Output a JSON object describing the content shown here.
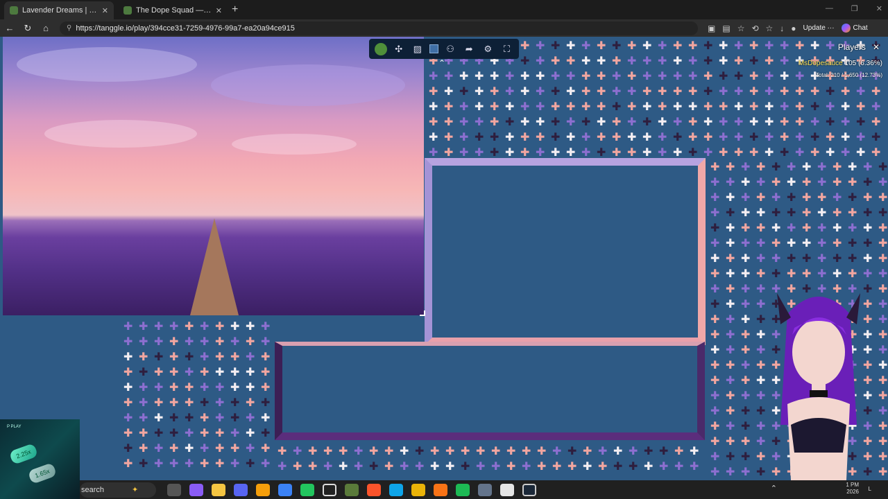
{
  "tabs": [
    {
      "title": "Lavender Dreams | Sky Jigsaw",
      "active": true
    },
    {
      "title": "The Dope Squad — Puzzles",
      "active": false
    }
  ],
  "address": {
    "url": "https://tanggle.io/play/394cce31-7259-4976-99a7-ea20a94ce915"
  },
  "browser_buttons": {
    "update": "Update ···",
    "chat": "Chat"
  },
  "toolbar": {
    "icons": [
      "tanggle-logo-icon",
      "puzzle-piece-icon",
      "image-icon",
      "background-color-icon",
      "players-icon",
      "share-icon",
      "settings-icon",
      "fullscreen-icon"
    ]
  },
  "players_panel": {
    "title": "Players",
    "close": "✕",
    "player_name": "MsDopesauce",
    "player_score": "105 (6.36%)",
    "total": "Total: 210 / 1,650 (12.73%)"
  },
  "ad": {
    "brand": "P PLAY",
    "label1": "2.25x",
    "label2": "1.65x"
  },
  "taskbar": {
    "search": "search",
    "time": "1 PM",
    "date": "2026",
    "lang": "L"
  },
  "colors": {
    "board": "#2e5a85",
    "piece_pink": "#f2a6a0",
    "piece_purple": "#8d6fd0",
    "piece_white": "#f4eef2",
    "piece_dark": "#2e1e3e",
    "frame": "#e7a3b0"
  }
}
